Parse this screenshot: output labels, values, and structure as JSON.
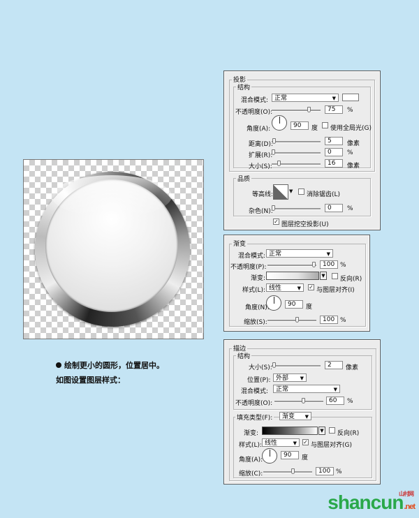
{
  "caption": {
    "line1": "绘制更小的圆形，位置居中。",
    "line2": "如图设置图层样式："
  },
  "drop_shadow": {
    "title": "投影",
    "structure": "结构",
    "blend_mode_label": "混合模式:",
    "blend_mode_value": "正常",
    "opacity_label": "不透明度(O):",
    "opacity_value": "75",
    "angle_label": "角度(A):",
    "angle_value": "90",
    "angle_unit": "度",
    "global_light_label": "使用全局光(G)",
    "global_light_checked": false,
    "distance_label": "距离(D):",
    "distance_value": "5",
    "spread_label": "扩展(R):",
    "spread_value": "0",
    "size_label": "大小(S):",
    "size_value": "16",
    "pixel_unit": "像素",
    "percent_unit": "%",
    "quality": "品质",
    "contour_label": "等高线:",
    "anti_alias_label": "消除锯齿(L)",
    "anti_alias_checked": false,
    "noise_label": "杂色(N):",
    "noise_value": "0",
    "knockout_label": "图层挖空投影(U)",
    "knockout_checked": true
  },
  "gradient_overlay": {
    "title": "渐变",
    "blend_mode_label": "混合模式:",
    "blend_mode_value": "正常",
    "opacity_label": "不透明度(P):",
    "opacity_value": "100",
    "gradient_label": "渐变:",
    "reverse_label": "反向(R)",
    "reverse_checked": false,
    "style_label": "样式(L):",
    "style_value": "线性",
    "align_label": "与图层对齐(I)",
    "align_checked": true,
    "angle_label": "角度(N):",
    "angle_value": "90",
    "angle_unit": "度",
    "scale_label": "缩放(S):",
    "scale_value": "100",
    "percent_unit": "%"
  },
  "stroke": {
    "title": "描边",
    "structure": "结构",
    "size_label": "大小(S):",
    "size_value": "2",
    "pixel_unit": "像素",
    "position_label": "位置(P):",
    "position_value": "外部",
    "blend_mode_label": "混合模式:",
    "blend_mode_value": "正常",
    "opacity_label": "不透明度(O):",
    "opacity_value": "60",
    "percent_unit": "%",
    "fill_type_label": "填充类型(F):",
    "fill_type_value": "渐变",
    "gradient_label": "渐变:",
    "reverse_label": "反向(R)",
    "reverse_checked": false,
    "style_label": "样式(L):",
    "style_value": "线性",
    "align_label": "与图层对齐(G)",
    "align_checked": true,
    "angle_label": "角度(A):",
    "angle_value": "90",
    "angle_unit": "度",
    "scale_label": "缩放(C):",
    "scale_value": "100"
  },
  "watermark": {
    "text": "shancun",
    "suffix": ".net",
    "cn": "山村网"
  }
}
